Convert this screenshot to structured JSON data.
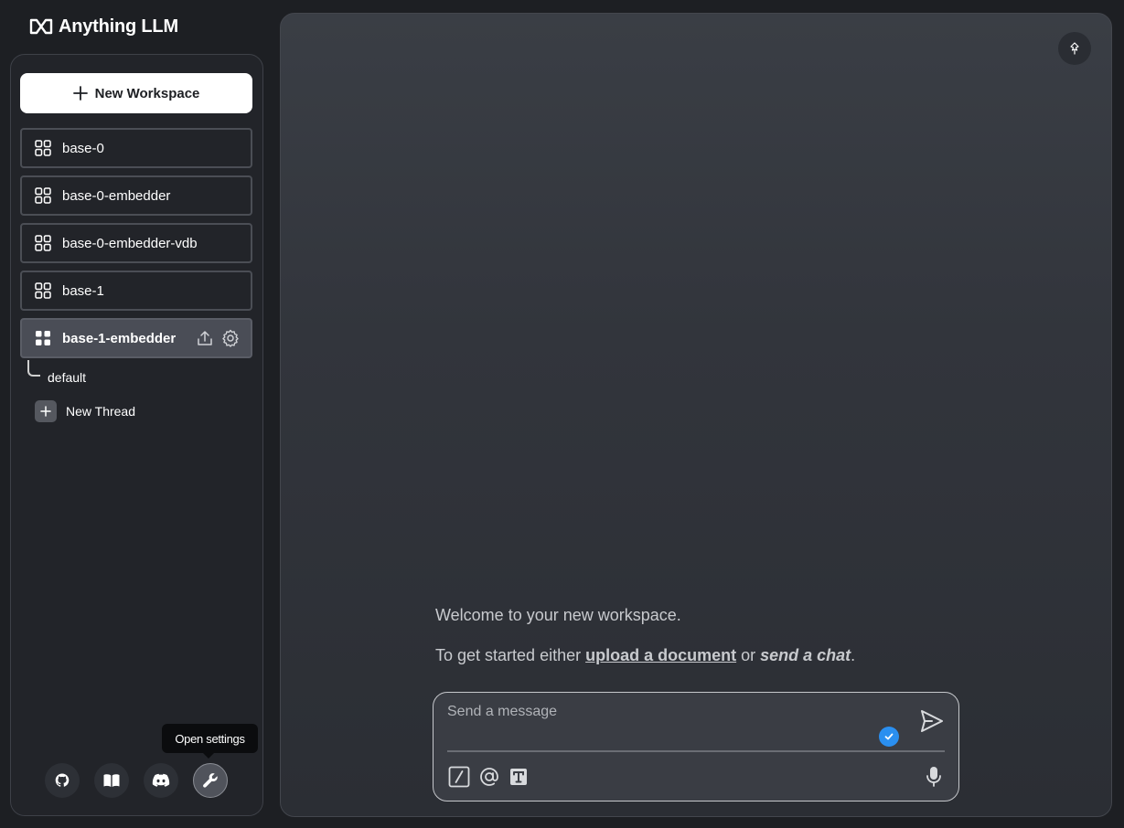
{
  "app": {
    "name": "Anything LLM"
  },
  "sidebar": {
    "new_workspace_label": "New Workspace",
    "workspaces": [
      {
        "label": "base-0",
        "active": false
      },
      {
        "label": "base-0-embedder",
        "active": false
      },
      {
        "label": "base-0-embedder-vdb",
        "active": false
      },
      {
        "label": "base-1",
        "active": false
      },
      {
        "label": "base-1-embedder",
        "active": true
      }
    ],
    "threads": [
      {
        "label": "default"
      }
    ],
    "new_thread_label": "New Thread",
    "footer_buttons": [
      {
        "icon": "github-icon"
      },
      {
        "icon": "book-icon"
      },
      {
        "icon": "discord-icon"
      },
      {
        "icon": "wrench-icon"
      }
    ],
    "tooltip": "Open settings"
  },
  "main": {
    "welcome_text": "Welcome to your new workspace.",
    "getting_started": {
      "prefix": "To get started either ",
      "upload_link": "upload a document",
      "middle": " or ",
      "chat_link": "send a chat",
      "suffix": "."
    },
    "input": {
      "placeholder": "Send a message"
    }
  },
  "colors": {
    "background": "#1d1f23",
    "accent_blue": "#2a8ff0",
    "button_white": "#ffffff"
  }
}
